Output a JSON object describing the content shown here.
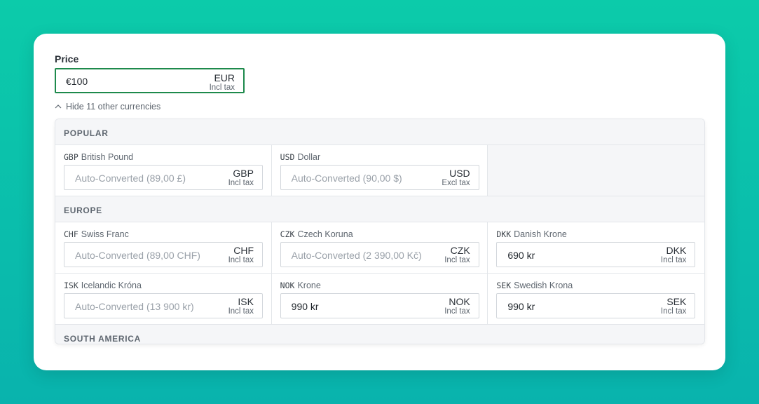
{
  "price": {
    "label": "Price",
    "value": "€100",
    "currency": "EUR",
    "tax": "Incl tax"
  },
  "toggle": {
    "label": "Hide 11 other currencies"
  },
  "sections": [
    {
      "title": "POPULAR",
      "rows": [
        [
          {
            "code": "GBP",
            "name": "British Pound",
            "placeholder": "Auto-Converted (89,00 £)",
            "value": "",
            "currency": "GBP",
            "tax": "Incl tax"
          },
          {
            "code": "USD",
            "name": "Dollar",
            "placeholder": "Auto-Converted (90,00 $)",
            "value": "",
            "currency": "USD",
            "tax": "Excl tax"
          }
        ]
      ]
    },
    {
      "title": "EUROPE",
      "rows": [
        [
          {
            "code": "CHF",
            "name": "Swiss Franc",
            "placeholder": "Auto-Converted (89,00 CHF)",
            "value": "",
            "currency": "CHF",
            "tax": "Incl tax"
          },
          {
            "code": "CZK",
            "name": "Czech Koruna",
            "placeholder": "Auto-Converted (2 390,00 Kč)",
            "value": "",
            "currency": "CZK",
            "tax": "Incl tax"
          },
          {
            "code": "DKK",
            "name": "Danish Krone",
            "placeholder": "",
            "value": "690 kr",
            "currency": "DKK",
            "tax": "Incl tax"
          }
        ],
        [
          {
            "code": "ISK",
            "name": "Icelandic Króna",
            "placeholder": "Auto-Converted (13 900 kr)",
            "value": "",
            "currency": "ISK",
            "tax": "Incl tax"
          },
          {
            "code": "NOK",
            "name": "Krone",
            "placeholder": "",
            "value": "990 kr",
            "currency": "NOK",
            "tax": "Incl tax"
          },
          {
            "code": "SEK",
            "name": "Swedish Krona",
            "placeholder": "",
            "value": "990 kr",
            "currency": "SEK",
            "tax": "Incl tax"
          }
        ]
      ]
    },
    {
      "title": "SOUTH AMERICA",
      "rows": []
    }
  ]
}
